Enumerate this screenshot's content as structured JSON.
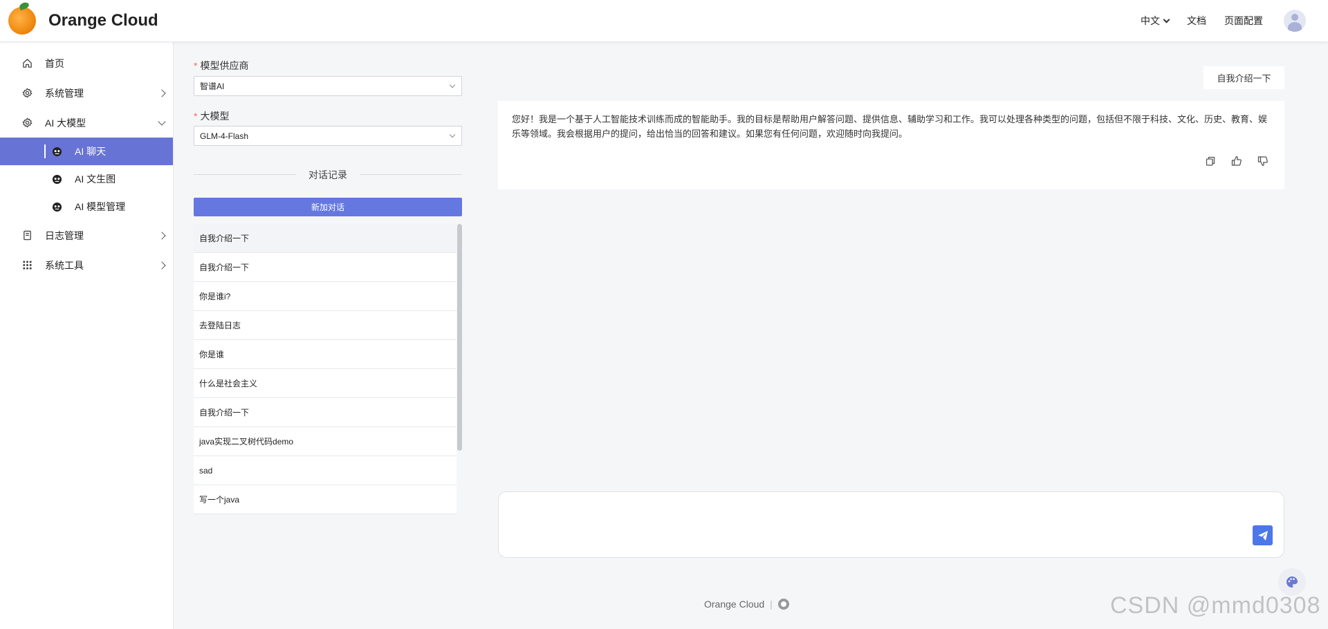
{
  "header": {
    "app_name": "Orange Cloud",
    "lang_label": "中文",
    "docs_label": "文档",
    "page_config_label": "页面配置"
  },
  "sidebar": {
    "items": [
      {
        "label": "首页",
        "icon": "home-icon"
      },
      {
        "label": "系统管理",
        "icon": "gear-icon"
      },
      {
        "label": "AI 大模型",
        "icon": "gear-icon",
        "expanded": true
      },
      {
        "label": "日志管理",
        "icon": "document-icon"
      },
      {
        "label": "系统工具",
        "icon": "grid-icon"
      }
    ],
    "ai_sub_items": [
      {
        "label": "AI 聊天",
        "active": true
      },
      {
        "label": "AI 文生图"
      },
      {
        "label": "AI 模型管理"
      }
    ]
  },
  "panel": {
    "provider_label": "模型供应商",
    "provider_value": "智谱AI",
    "model_label": "大模型",
    "model_value": "GLM-4-Flash",
    "history_title": "对话记录",
    "new_chat_label": "新加对话",
    "history": [
      "自我介绍一下",
      "自我介绍一下",
      "你是谁i?",
      "去登陆日志",
      "你是谁",
      "什么是社会主义",
      "自我介绍一下",
      "java实现二叉树代码demo",
      "sad",
      "写一个java"
    ]
  },
  "chat": {
    "user_message": "自我介绍一下",
    "bot_reply": "您好！我是一个基于人工智能技术训练而成的智能助手。我的目标是帮助用户解答问题、提供信息、辅助学习和工作。我可以处理各种类型的问题，包括但不限于科技、文化、历史、教育、娱乐等领域。我会根据用户的提问，给出恰当的回答和建议。如果您有任何问题，欢迎随时向我提问。",
    "input_value": "",
    "accent_color": "#4d77e8"
  },
  "footer": {
    "text": "Orange Cloud",
    "separator": "|"
  },
  "watermark": "CSDN @mmd0308",
  "colors": {
    "active_menu": "#6873d6",
    "primary_button": "#6478e0",
    "required_mark": "#f56c6c"
  }
}
